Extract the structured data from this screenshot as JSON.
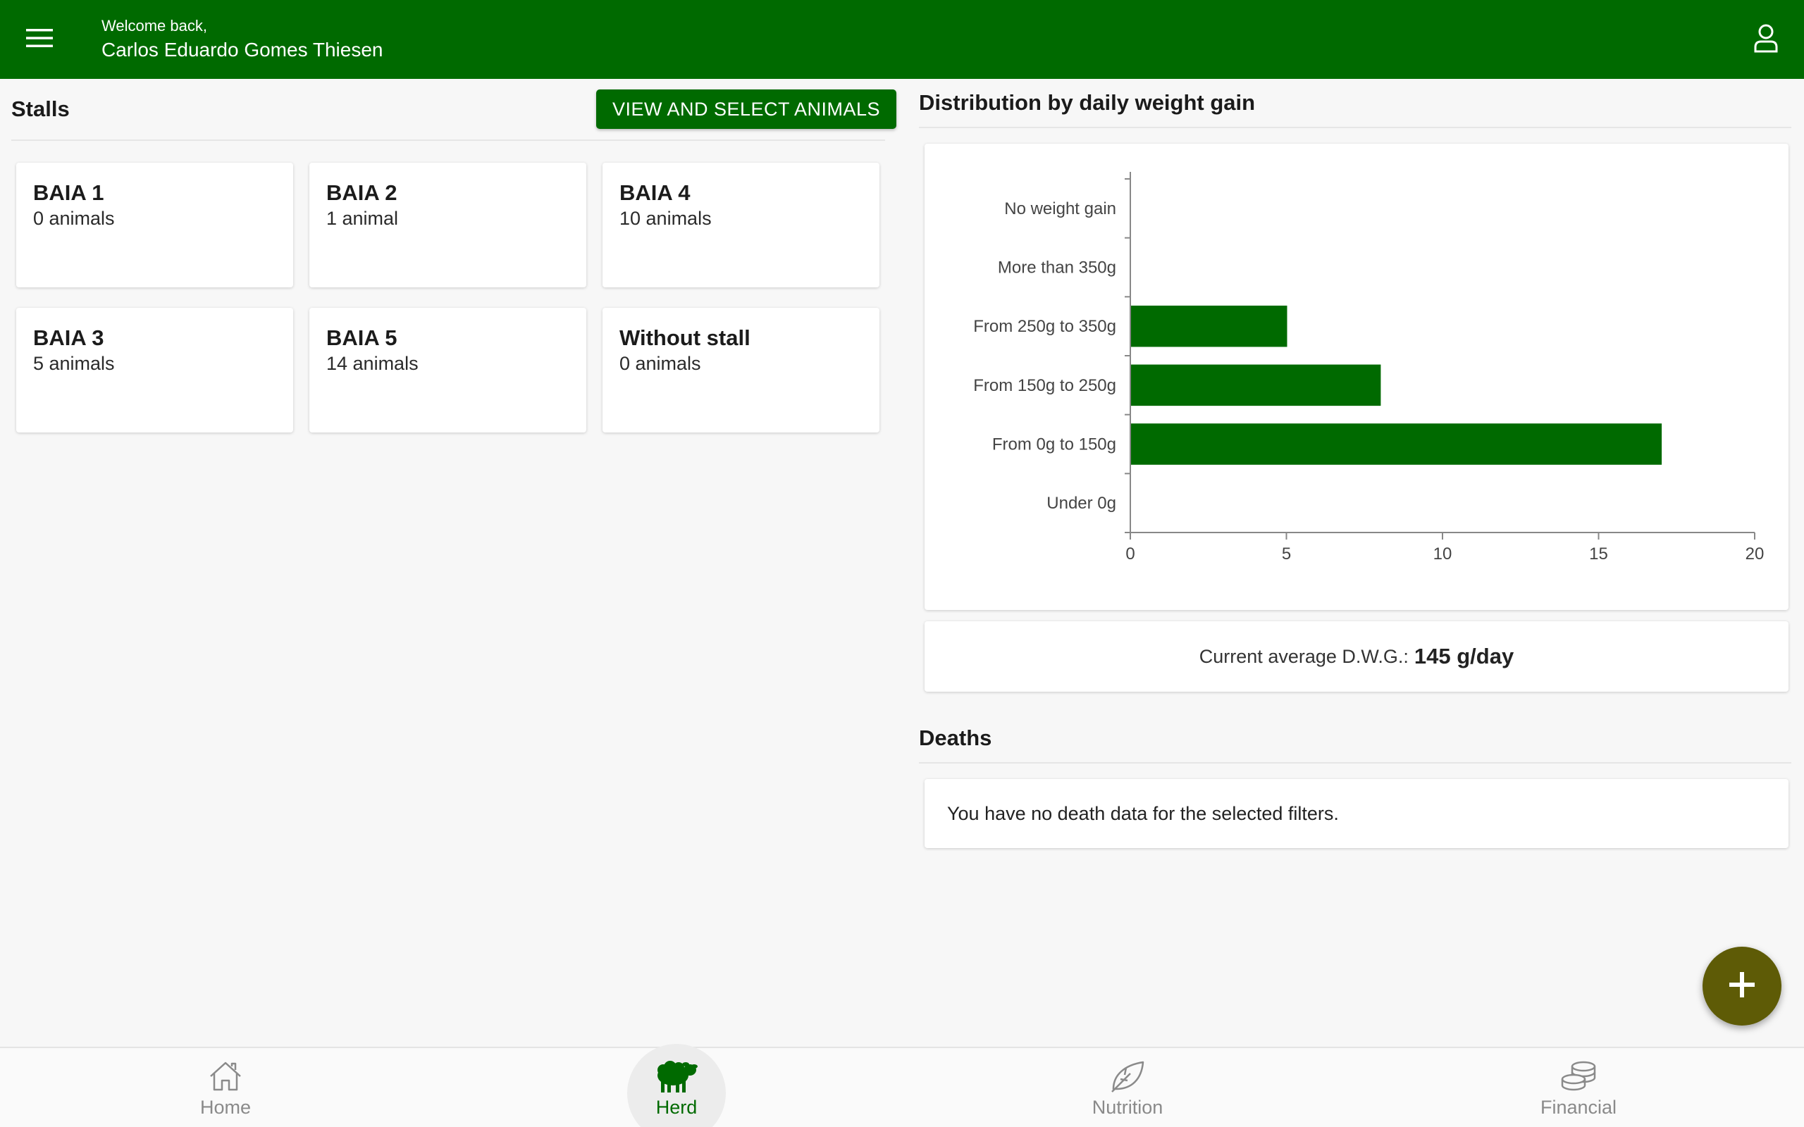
{
  "header": {
    "welcome": "Welcome back,",
    "user_name": "Carlos Eduardo Gomes Thiesen",
    "menu_icon": "hamburger-menu-icon",
    "profile_icon": "user-icon"
  },
  "stalls": {
    "title": "Stalls",
    "view_button": "VIEW AND SELECT ANIMALS",
    "items": [
      {
        "name": "BAIA 1",
        "count": "0 animals"
      },
      {
        "name": "BAIA 2",
        "count": "1 animal"
      },
      {
        "name": "BAIA 4",
        "count": "10 animals"
      },
      {
        "name": "BAIA 3",
        "count": "5 animals"
      },
      {
        "name": "BAIA 5",
        "count": "14 animals"
      },
      {
        "name": "Without stall",
        "count": "0 animals"
      }
    ]
  },
  "distribution": {
    "title": "Distribution by daily weight gain",
    "avg_label": "Current average D.W.G.:",
    "avg_value": "145 g/day"
  },
  "chart_data": {
    "type": "bar",
    "orientation": "horizontal",
    "categories": [
      "No weight gain",
      "More than 350g",
      "From 250g to 350g",
      "From 150g to 250g",
      "From 0g to 150g",
      "Under 0g"
    ],
    "values": [
      0,
      0,
      5,
      8,
      17,
      0
    ],
    "xlim": [
      0,
      20
    ],
    "xticks": [
      "0",
      "5",
      "10",
      "15",
      "20"
    ],
    "bar_color": "#006a00"
  },
  "deaths": {
    "title": "Deaths",
    "empty_message": "You have no death data for the selected filters."
  },
  "fab": {
    "icon": "plus-icon"
  },
  "bottom_nav": {
    "items": [
      {
        "label": "Home",
        "icon": "home-icon"
      },
      {
        "label": "Herd",
        "icon": "sheep-icon"
      },
      {
        "label": "Nutrition",
        "icon": "leaf-icon"
      },
      {
        "label": "Financial",
        "icon": "coins-icon"
      }
    ],
    "active_index": 1
  },
  "colors": {
    "primary": "#006a00",
    "fab": "#5e5b06"
  }
}
